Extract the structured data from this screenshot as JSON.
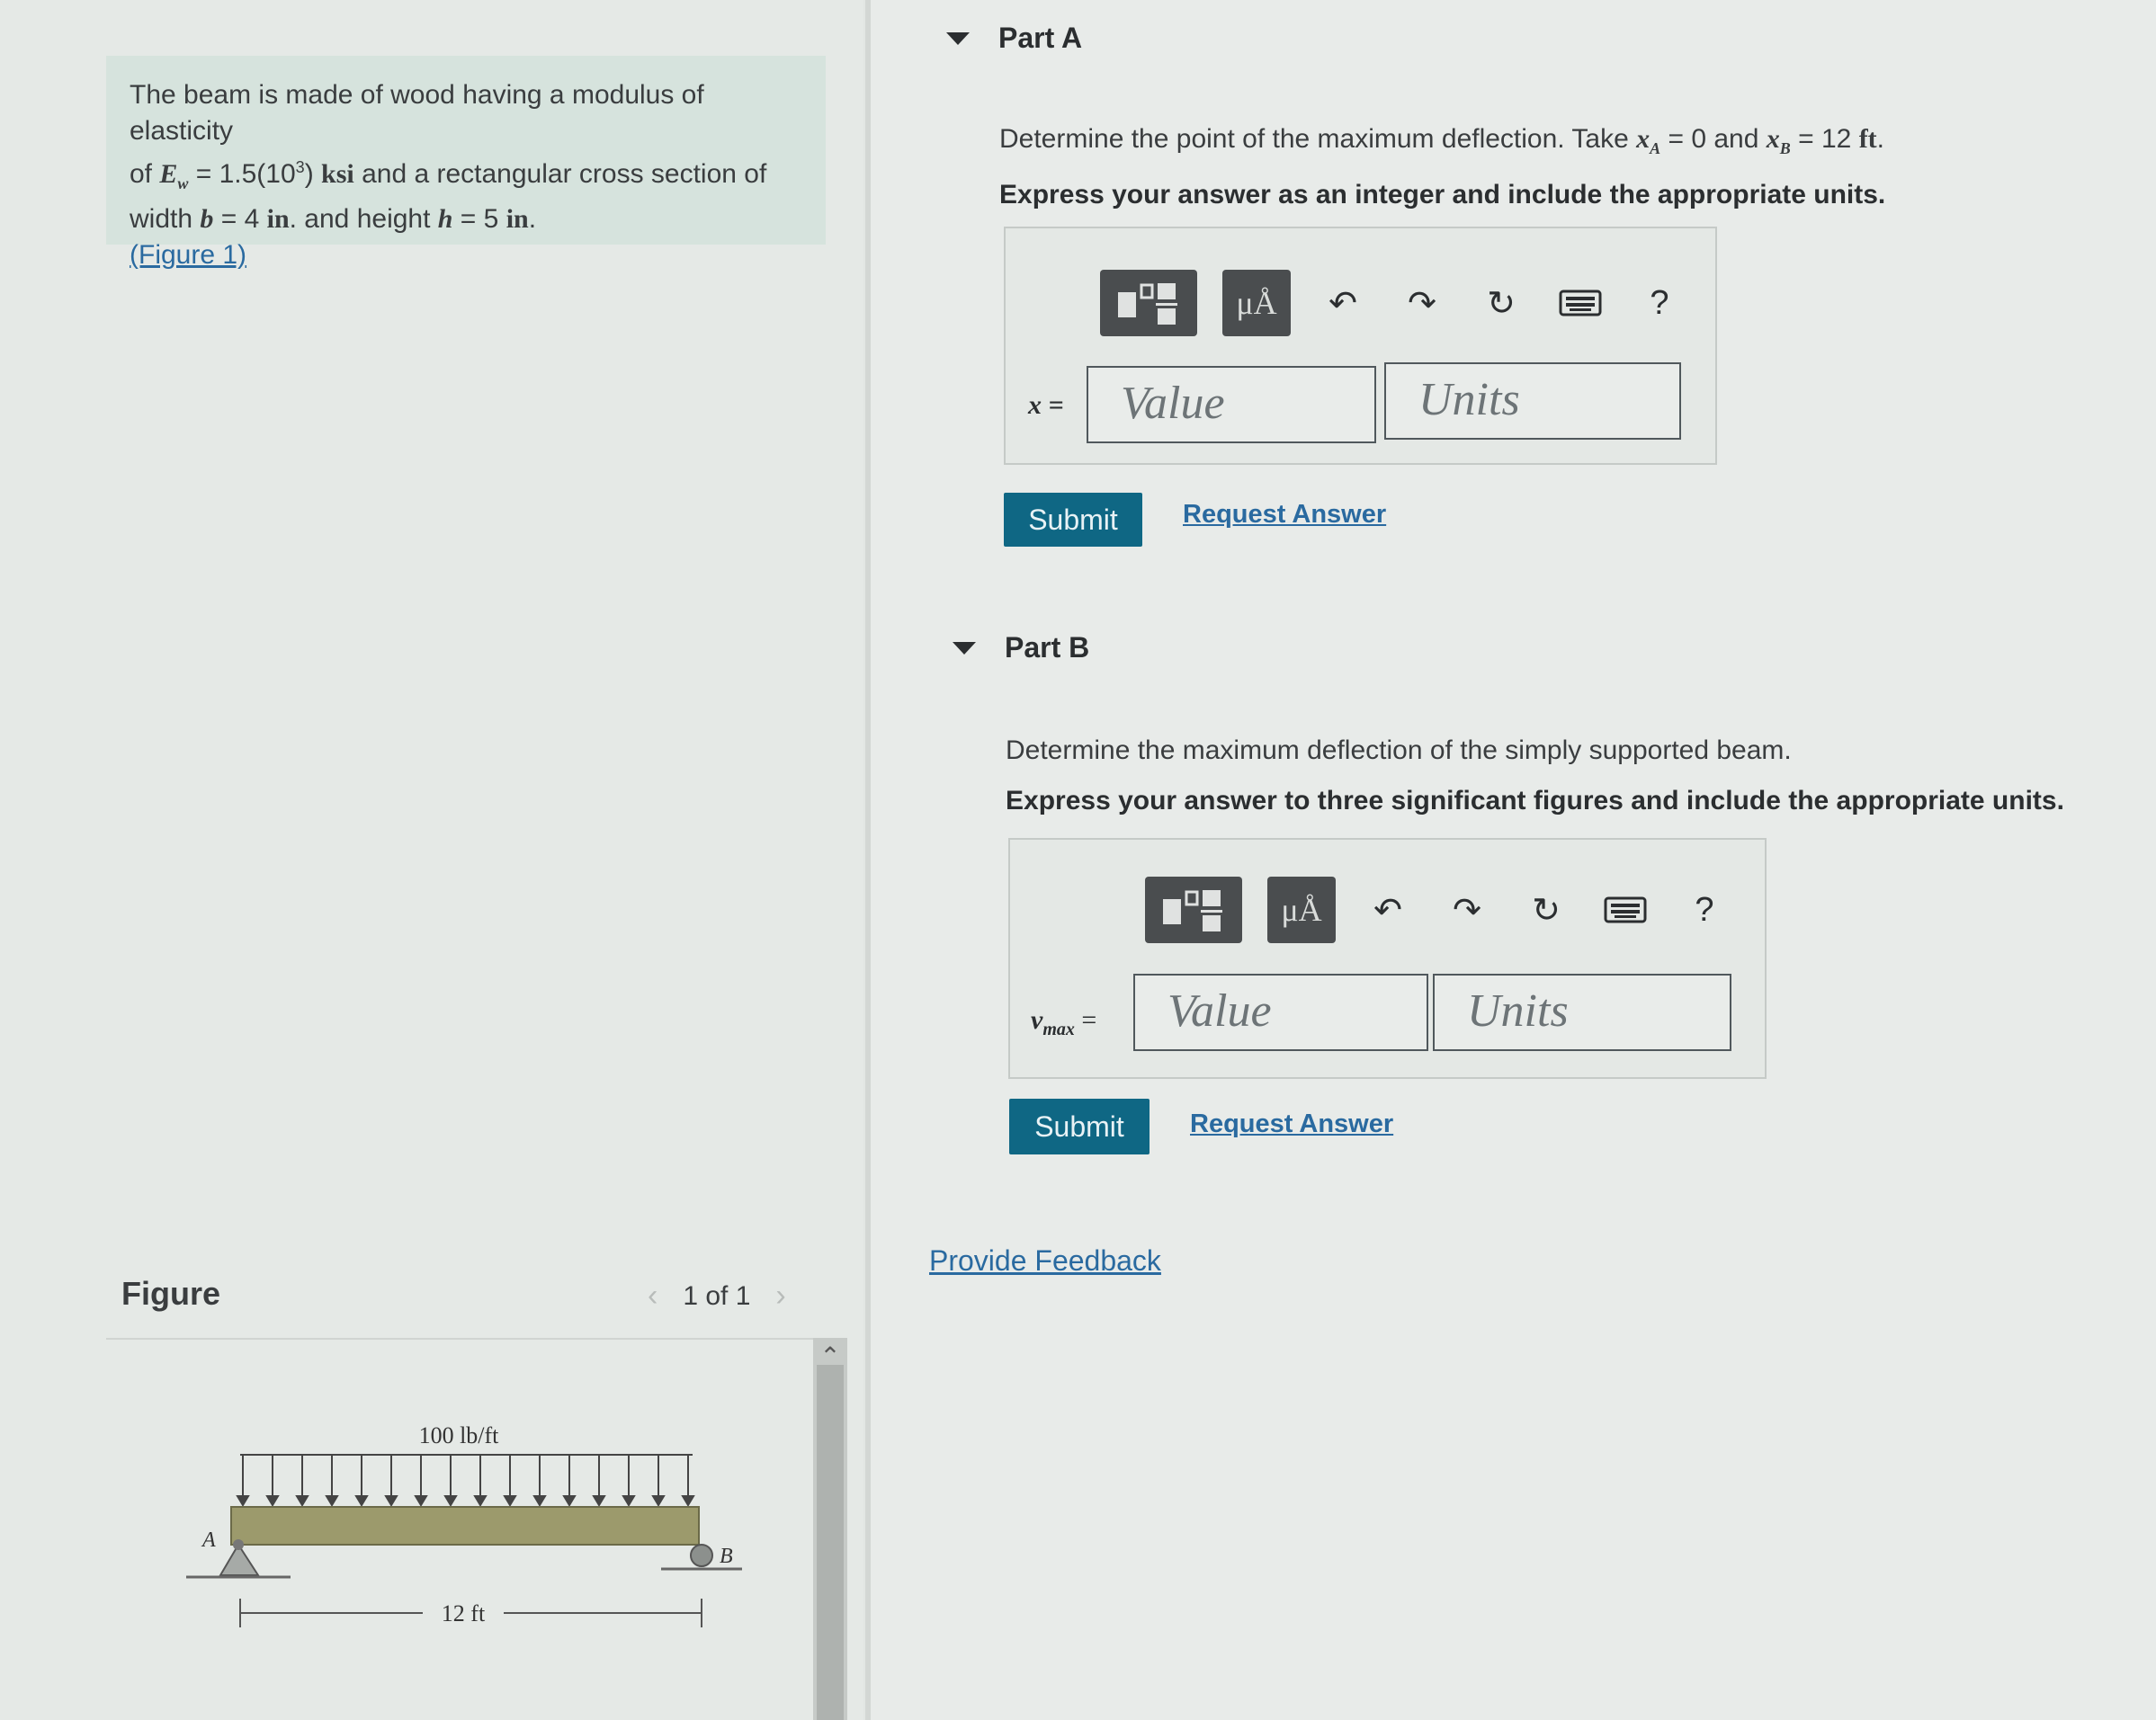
{
  "problem": {
    "line1": "The beam is made of wood having a modulus of elasticity",
    "line2_pre": "of",
    "e_symbol": "E",
    "e_sub": "w",
    "line2_eq": " = 1.5(10",
    "line2_exp": "3",
    "line2_close": ")",
    "line2_unit": "ksi",
    "line2_post": " and a rectangular cross section of",
    "line3_pre": "width",
    "b_symbol": "b",
    "b_eq": " = 4",
    "b_unit": "in",
    "line3_mid": ". and height",
    "h_symbol": "h",
    "h_eq": " = 5",
    "h_unit": "in",
    "line3_end": ".",
    "figure_link": "(Figure 1)"
  },
  "figure": {
    "label": "Figure",
    "pager": "1 of 1",
    "prev_icon": "chevron-left-icon",
    "next_icon": "chevron-right-icon",
    "load_label": "100 lb/ft",
    "span_label": "12 ft",
    "support_a": "A",
    "support_b": "B"
  },
  "partA": {
    "title": "Part A",
    "question_pre": "Determine the point of the maximum deflection. Take ",
    "xa_symbol": "x",
    "xa_sub": "A",
    "xa_eq": " = 0 and ",
    "xb_symbol": "x",
    "xb_sub": "B",
    "xb_eq": " = 12 ",
    "xb_unit": "ft",
    "question_end": ".",
    "instruction": "Express your answer as an integer and include the appropriate units.",
    "input_label": "x =",
    "value_placeholder": "Value",
    "units_placeholder": "Units",
    "submit": "Submit",
    "request": "Request Answer"
  },
  "partB": {
    "title": "Part B",
    "question": "Determine the maximum deflection of the simply supported beam.",
    "instruction": "Express your answer to three significant figures and include the appropriate units.",
    "input_label": "v",
    "input_sub": "max",
    "input_eq": " =",
    "value_placeholder": "Value",
    "units_placeholder": "Units",
    "submit": "Submit",
    "request": "Request Answer"
  },
  "toolbar": {
    "mu_label": "μÅ",
    "help_label": "?",
    "icons": [
      "templates-icon",
      "units-icon",
      "undo-icon",
      "redo-icon",
      "reset-icon",
      "keyboard-icon",
      "help-icon"
    ]
  },
  "feedback": "Provide Feedback"
}
